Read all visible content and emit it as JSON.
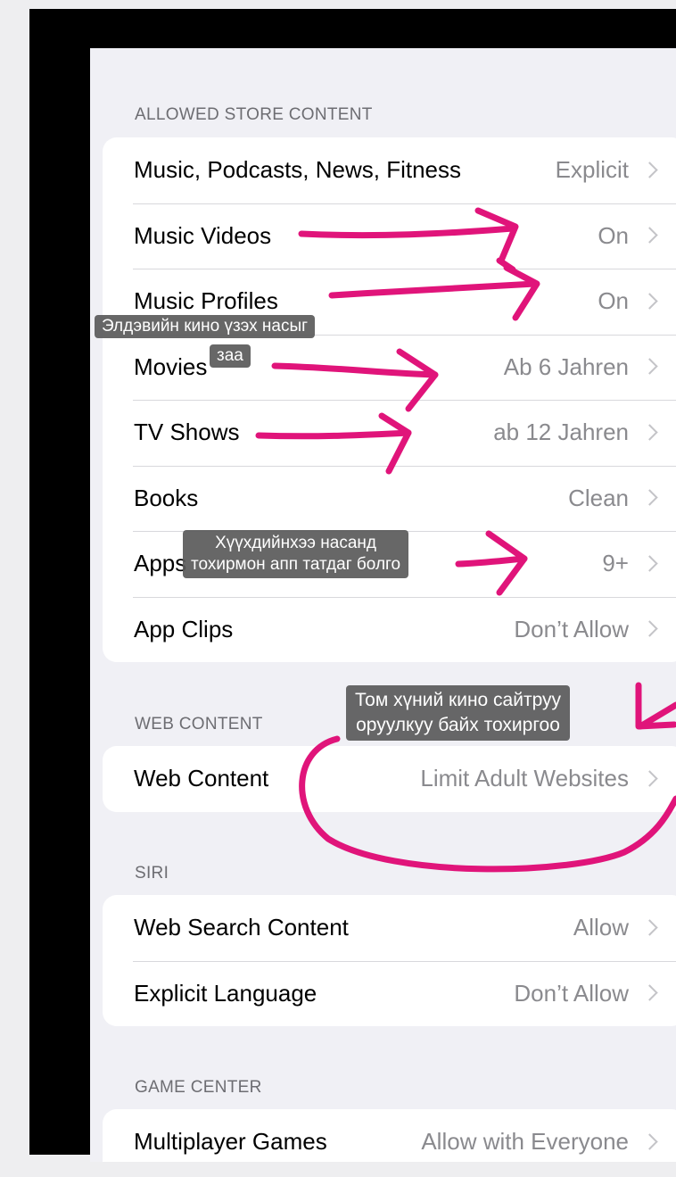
{
  "sections": {
    "store": {
      "header": "ALLOWED STORE CONTENT",
      "rows": [
        {
          "label": "Music, Podcasts, News, Fitness",
          "value": "Explicit"
        },
        {
          "label": "Music Videos",
          "value": "On"
        },
        {
          "label": "Music Profiles",
          "value": "On"
        },
        {
          "label": "Movies",
          "value": "Ab 6 Jahren"
        },
        {
          "label": "TV Shows",
          "value": "ab 12 Jahren"
        },
        {
          "label": "Books",
          "value": "Clean"
        },
        {
          "label": "Apps",
          "value": "9+"
        },
        {
          "label": "App Clips",
          "value": "Don’t Allow"
        }
      ]
    },
    "web": {
      "header": "WEB CONTENT",
      "rows": [
        {
          "label": "Web Content",
          "value": "Limit Adult Websites"
        }
      ]
    },
    "siri": {
      "header": "SIRI",
      "rows": [
        {
          "label": "Web Search Content",
          "value": "Allow"
        },
        {
          "label": "Explicit Language",
          "value": "Don’t Allow"
        }
      ]
    },
    "game_center": {
      "header": "GAME CENTER",
      "rows": [
        {
          "label": "Multiplayer Games",
          "value": "Allow with Everyone"
        }
      ]
    }
  },
  "annotations": {
    "movies_note_line1": "Элдэвийн кино үзэх насыг",
    "movies_note_line2": "заа",
    "apps_note_line1": "Хүүхдийнхээ насанд",
    "apps_note_line2": "тохирмон апп татдаг болго",
    "web_note_line1": "Том хүний кино сайтруу",
    "web_note_line2": "оруулкуу байх тохиргоо"
  },
  "colors": {
    "annotation_ink": "#e0147a",
    "screen_bg": "#f0f0f5",
    "value_gray": "#8a8a8e"
  },
  "icons": [
    "chevron-right-icon"
  ]
}
